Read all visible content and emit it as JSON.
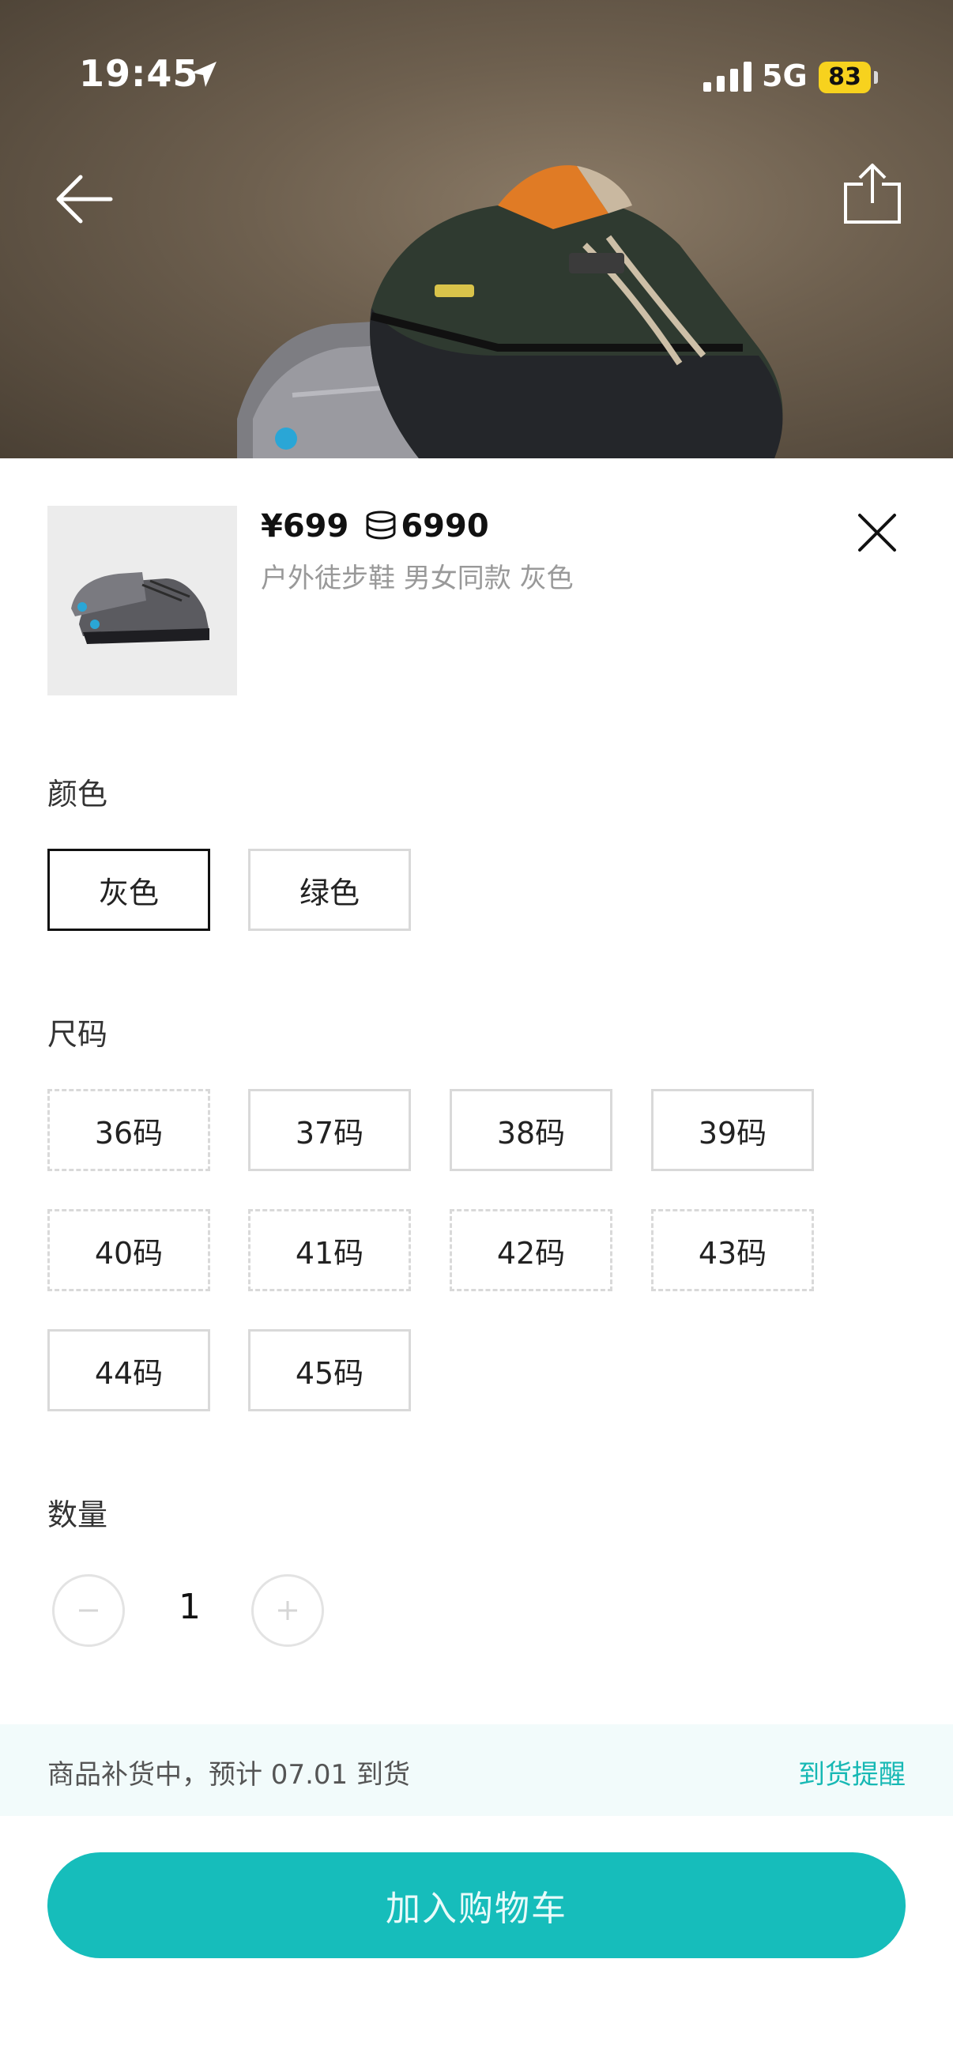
{
  "status_bar": {
    "time": "19:45",
    "network": "5G",
    "battery": "83",
    "battery_color": "#f7d21e"
  },
  "nav": {
    "back_icon": "arrow-left-icon",
    "share_icon": "share-icon"
  },
  "product": {
    "price": "¥699",
    "coin_icon": "coin-stack-icon",
    "coins": "6990",
    "title": "户外徒步鞋 男女同款 灰色"
  },
  "color": {
    "label": "颜色",
    "options": [
      "灰色",
      "绿色"
    ],
    "selected": "灰色"
  },
  "size": {
    "label": "尺码",
    "options": [
      "36码",
      "37码",
      "38码",
      "39码",
      "40码",
      "41码",
      "42码",
      "43码",
      "44码",
      "45码"
    ]
  },
  "quantity": {
    "label": "数量",
    "value": "1"
  },
  "notice": {
    "text": "商品补货中，预计 07.01 到货",
    "link": "到货提醒"
  },
  "cart_button": {
    "label": "加入购物车",
    "color": "#16bdbb"
  },
  "accent_color": "#17b8b4"
}
